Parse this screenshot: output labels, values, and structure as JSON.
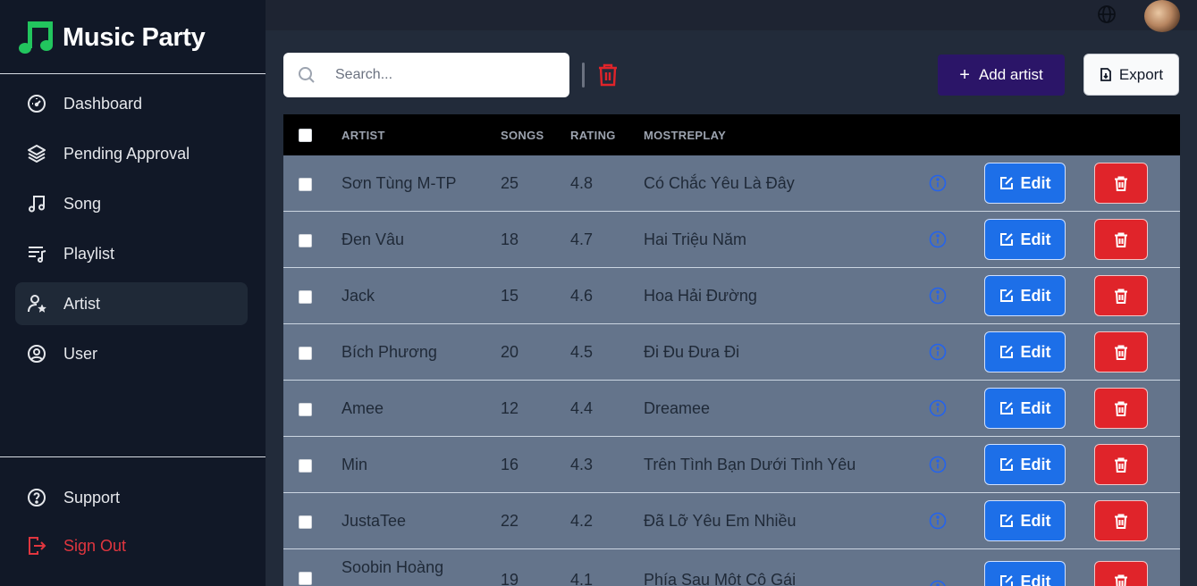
{
  "app": {
    "title": "Music Party"
  },
  "sidebar": {
    "items": [
      {
        "label": "Dashboard",
        "icon": "dashboard-icon"
      },
      {
        "label": "Pending Approval",
        "icon": "layers-icon"
      },
      {
        "label": "Song",
        "icon": "music-note-icon"
      },
      {
        "label": "Playlist",
        "icon": "playlist-icon"
      },
      {
        "label": "Artist",
        "icon": "artist-icon",
        "active": true
      },
      {
        "label": "User",
        "icon": "user-circle-icon"
      }
    ],
    "bottom": [
      {
        "label": "Support",
        "icon": "help-icon"
      },
      {
        "label": "Sign Out",
        "icon": "sign-out-icon"
      }
    ]
  },
  "toolbar": {
    "search_placeholder": "Search...",
    "add_label": "Add artist",
    "export_label": "Export"
  },
  "table": {
    "columns": [
      "ARTIST",
      "SONGS",
      "RATING",
      "MOSTREPLAY"
    ],
    "edit_label": "Edit",
    "rows": [
      {
        "artist": "Sơn Tùng M-TP",
        "songs": "25",
        "rating": "4.8",
        "mostreplay": "Có Chắc Yêu Là Đây"
      },
      {
        "artist": "Đen Vâu",
        "songs": "18",
        "rating": "4.7",
        "mostreplay": "Hai Triệu Năm"
      },
      {
        "artist": "Jack",
        "songs": "15",
        "rating": "4.6",
        "mostreplay": "Hoa Hải Đường"
      },
      {
        "artist": "Bích Phương",
        "songs": "20",
        "rating": "4.5",
        "mostreplay": "Đi Đu Đưa Đi"
      },
      {
        "artist": "Amee",
        "songs": "12",
        "rating": "4.4",
        "mostreplay": "Dreamee"
      },
      {
        "artist": "Min",
        "songs": "16",
        "rating": "4.3",
        "mostreplay": "Trên Tình Bạn Dưới Tình Yêu"
      },
      {
        "artist": "JustaTee",
        "songs": "22",
        "rating": "4.2",
        "mostreplay": "Đã Lỡ Yêu Em Nhiều"
      },
      {
        "artist": "Soobin Hoàng",
        "songs": "19",
        "rating": "4.1",
        "mostreplay": "Phía Sau Một Cô Gái"
      }
    ]
  },
  "colors": {
    "sidebar_bg": "#111827",
    "main_bg": "#222b3a",
    "row_bg": "#64748b",
    "accent_green": "#22c55e",
    "edit_blue": "#1d6fe8",
    "delete_red": "#e0242a",
    "add_purple": "#2b1568",
    "signout_red": "#e0363f"
  }
}
